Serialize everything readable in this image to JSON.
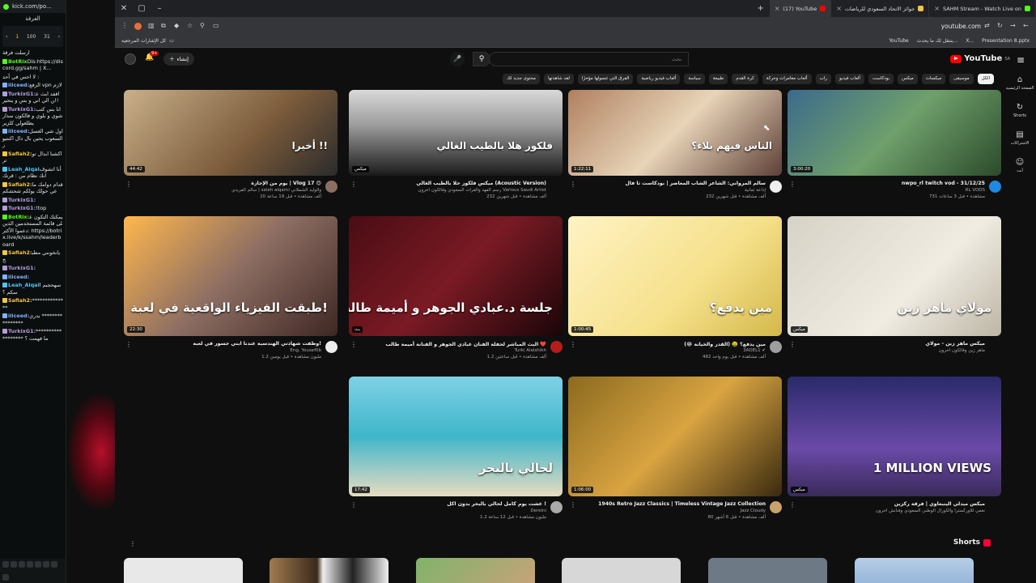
{
  "chat": {
    "tab_title": "kick.com/po...",
    "header": "الغرفة",
    "box": {
      "label": "الملخص",
      "left_num": "1",
      "mid1": "100",
      "mid2": "1",
      "right1": "31",
      "right2": "24"
    },
    "messages": [
      {
        "user": "",
        "text": "ارسلت فرقة",
        "color": "#ddd"
      },
      {
        "user": "BotRix",
        "text": "Dis:https://discord.gg/sahm | X...",
        "color": "#53fc18"
      },
      {
        "user": "",
        "text": "لا احس في أحد :",
        "color": "#ddd"
      },
      {
        "user": "iiiceed:",
        "text": "الرفع vpn لازم",
        "color": "#7fb3ff"
      },
      {
        "user": "TurkixG1:",
        "text": "اقفد ابث عن الي اني و بس و ينحير!!",
        "color": "#b39ddb"
      },
      {
        "user": "TurkixG1:",
        "text": "انا بس كتب شوي و بلوي و فالكون سدار يطلعولي كلزير",
        "color": "#b39ddb"
      },
      {
        "user": "iiiceed:",
        "text": "اول شي الغسل السعوب يحين بال دال اكنتيور",
        "color": "#7fb3ff"
      },
      {
        "user": "Safiah2:",
        "text": "اكشنا ابدال توتر",
        "color": "#f5c542"
      },
      {
        "user": "Leah_Aiqal",
        "text": "أنا اتشوف انك نظام من : قرنك",
        "color": "#4fc3f7"
      },
      {
        "user": "Safiah2:",
        "text": "قدام دوامك ماعي حولك يولكم شحشكم",
        "color": "#f5c542"
      },
      {
        "user": "TurkixG1:",
        "text": "",
        "color": "#b39ddb"
      },
      {
        "user": "TurkixG1:",
        "text": "!top",
        "color": "#b39ddb"
      },
      {
        "user": "BotRix:",
        "text": "يمكنك التكون على قائمة المستخدمين الذين دعموا الأكثر: https://botrix.live/k/ssahm/leaderboard",
        "color": "#53fc18"
      },
      {
        "user": "Safiah2:",
        "text": "يانخونني مطبخ",
        "color": "#f5c542"
      },
      {
        "user": "TurkixG1:",
        "text": "",
        "color": "#b39ddb"
      },
      {
        "user": "iiiceed:",
        "text": "",
        "color": "#7fb3ff"
      },
      {
        "user": "Leah_Aiqal",
        "text": "سهحجبم اسكم ؟",
        "color": "#4fc3f7"
      },
      {
        "user": "Safiah2:",
        "text": "**************",
        "color": "#f5c542"
      },
      {
        "user": "iiiceed:",
        "text": "بدري ****************",
        "color": "#7fb3ff"
      },
      {
        "user": "TurkixG1:",
        "text": "****************** ما فهمت ؟",
        "color": "#b39ddb"
      }
    ]
  },
  "browser": {
    "tabs": [
      {
        "title": "(17) YouTube",
        "color": "#ff0000",
        "active": true
      },
      {
        "title": "جوائز الاتحاد السعودي للرياضات",
        "color": "#f5c542",
        "active": false
      },
      {
        "title": "SAHM Stream - Watch Live on",
        "color": "#53fc18",
        "active": false
      }
    ],
    "url": "youtube.com",
    "bookmarks_left": "كل الإشارات المرجعية",
    "bookmarks_right": [
      "YouTube",
      "ينتقل لك ما يحدث...",
      "X...",
      "Presentation 8.pptx"
    ]
  },
  "youtube": {
    "logo_text": "YouTube",
    "logo_region": "SA",
    "search_placeholder": "بحث",
    "create_label": "إنشاء",
    "notif_count": "9+",
    "chips": [
      "الكل",
      "موسيقى",
      "ميكسات",
      "ميكس",
      "بودكاست",
      "ألعاب فيديو",
      "راب",
      "ألعاب مغامرات وحركة",
      "كرة القدم",
      "طبيعة",
      "سياسة",
      "ألعاب فيديو رياضية",
      "الفرق التي تتسولها مؤخرًا",
      "لقد شاهدتها",
      "محتوى جديد لك"
    ],
    "rail": [
      {
        "icon": "⌂",
        "label": "الصفحة الرئيسية"
      },
      {
        "icon": "↻",
        "label": "Shorts"
      },
      {
        "icon": "▤",
        "label": "الاشتراكات"
      },
      {
        "icon": "☺",
        "label": "أنت"
      }
    ],
    "videos": [
      {
        "title": "يوم من الإجازة | Vlog 17 😍",
        "channel": "سالم الفريدي | saleh alqarni والوليد الشملاني",
        "meta": "20 ألف مشاهدة • قبل 19 ساعة",
        "duration": "44:42",
        "thumb_text": "أخيرا !!",
        "bg": "linear-gradient(135deg,#c9b08a,#7a5a3a 60%,#2b2b2b)",
        "av": "#8d6e63"
      },
      {
        "title": "ميكس فلكور حلا بالطيب الغالي (Acoustic Version)",
        "channel": "رسم الفهد والفرات السعودي وفالكون آخرون Various Saudi Artist",
        "meta": "232 ألف مشاهدة • قبل شهرين",
        "duration": "ميكس",
        "thumb_text": "فلكور هلا بالطيب الغالي",
        "bg": "linear-gradient(180deg,#d9d9d9 0%,#9e9e9e 40%,#1a1a1a 100%)",
        "av": ""
      },
      {
        "title": "سالم المرواني: الشاعر الشاب المعاصر | بودكاست ثا فال",
        "channel": "إذاعة ثمانية",
        "meta": "232 ألف مشاهدة • قبل شهرين",
        "duration": "1:22:11",
        "thumb_text": "الناس فيهم بلاء؟",
        "bg": "linear-gradient(135deg,#b08060,#e8d4b8 50%,#5d4037)",
        "av": "#eee"
      },
      {
        "title": "nwpo_rl twitch vod - 31/12/25",
        "channel": "RL VODS",
        "meta": "731 مشاهدة • قبل 3 ساعات",
        "duration": "3:00:20",
        "thumb_text": "",
        "bg": "linear-gradient(135deg,#3b6a8c,#6fa06b 50%,#2b4a2b)",
        "av": "#1e88e5"
      },
      {
        "title": "وظفت شهادتي الهندسية عندنا ابني جسور في لعبة!",
        "channel": "Eng. Yousef0b",
        "meta": "1.2 مليون مشاهدة • قبل يومين",
        "duration": "22:30",
        "thumb_text": "طبقت الفيزياء الواقعية في لعبة!",
        "bg": "linear-gradient(135deg,#ffb74d,#8d6e63 50%,#3e2723)",
        "av": "#eee"
      },
      {
        "title": "البث المباشر لحفلة الفنان عبادي الجوهر و الفنانة أميمة طالب ❤️",
        "channel": "Turki Alalshikh",
        "meta": "1.2 ألف مشاهدة • قبل ساعتين",
        "duration": "بث",
        "thumb_text": "جلسة د.عبادي الجوهر و أميمة طالب",
        "bg": "linear-gradient(135deg,#4a0d14,#7a1a24 50%,#1a0508)",
        "av": "#b71c1c"
      },
      {
        "title": "مين يدفع؟ 🤑 (القدر والخيانة 😂)",
        "channel": "3ADEL1 ✔",
        "meta": "482 ألف مشاهدة • قبل يوم واحد",
        "duration": "1:00:45",
        "thumb_text": "مين يدفع؟",
        "bg": "linear-gradient(135deg,#fff3c4,#f5e08a 60%,#d4b84a)",
        "av": "#9e9e9e"
      },
      {
        "title": "ميكس ماهر زين - مولاي",
        "channel": "ماهر زين وفالكون آخرون",
        "meta": "",
        "duration": "ميكس",
        "thumb_text": "مولاي ماهر زين",
        "bg": "linear-gradient(135deg,#d7d2c6,#f0ece2 60%,#bdb6a6)",
        "av": ""
      },
      {
        "title": "عشت يوم كامل لحالي بالبحر بدون اكل !",
        "channel": "Dereini",
        "meta": "1.2 مليون مشاهدة • قبل 12 ساعة",
        "duration": "17:42",
        "thumb_text": "لحالي بالبحر",
        "bg": "linear-gradient(180deg,#7fd1e6,#3fb6c9 50%,#e7dcc0)",
        "av": "#aaa"
      },
      {
        "title": "1940s Retro Jazz Classics | Timeless Vintage Jazz Collection",
        "channel": "Jazz Cloudy",
        "meta": "80 ألف مشاهدة • قبل 6 أشهر",
        "duration": "1:06:00",
        "thumb_text": "",
        "bg": "linear-gradient(135deg,#8b6a1f,#d9a441 50%,#3a2a10)",
        "av": "#c8a46a"
      },
      {
        "title": "ميكس ميدلي الينبعاوي | فرقة ركزين",
        "channel": "نغمي للأوركسترا والكورال الوطني السعودي وفنانش آخرون",
        "meta": "",
        "duration": "ميكس",
        "thumb_text": "1 MILLION VIEWS",
        "bg": "linear-gradient(180deg,#2a2a6a,#6a4aa8 60%,#3a2a5a)",
        "av": ""
      }
    ],
    "shorts_label": "Shorts"
  }
}
